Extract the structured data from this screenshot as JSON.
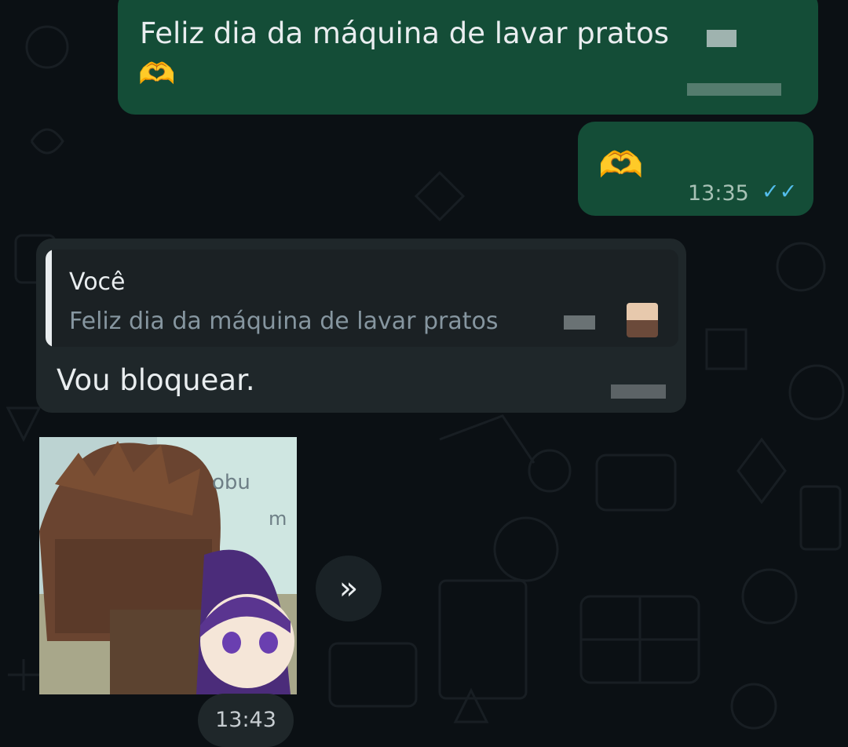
{
  "messages": {
    "outgoing_1": {
      "text": "Feliz dia da máquina de lavar pratos",
      "emoji": "🫶"
    },
    "outgoing_2": {
      "emoji": "🫶",
      "time": "13:35",
      "ticks": "✓✓"
    },
    "incoming_reply": {
      "quote_author": "Você",
      "quote_text": "Feliz dia da máquina de lavar pratos",
      "text": "Vou bloquear."
    },
    "sticker_message": {
      "sticker_text_1": "obu",
      "sticker_text_2": "m",
      "forward_icon": "»",
      "time": "13:43"
    }
  },
  "colors": {
    "background": "#0b1014",
    "outgoing_bubble": "#144d37",
    "incoming_bubble": "#1f272a",
    "read_ticks": "#53bdeb"
  }
}
